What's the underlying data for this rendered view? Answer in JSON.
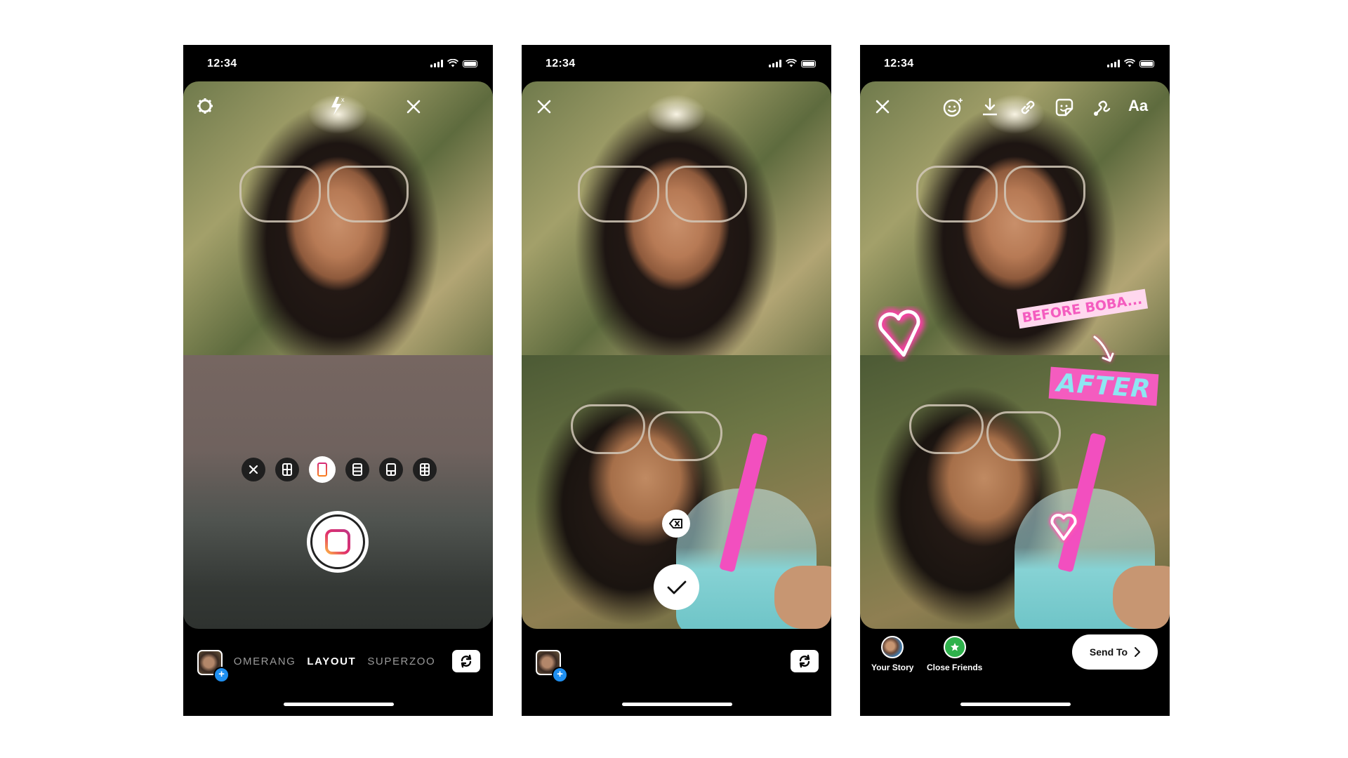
{
  "status_bar": {
    "time": "12:34"
  },
  "phone1": {
    "top_icons": [
      "settings-icon",
      "flash-off-icon",
      "close-icon"
    ],
    "layout_options": [
      {
        "name": "close-layout-icon",
        "selected": false
      },
      {
        "name": "grid-2x2-icon",
        "selected": false
      },
      {
        "name": "split-2-vertical-icon",
        "selected": true
      },
      {
        "name": "split-3-rows-icon",
        "selected": false
      },
      {
        "name": "split-top-bottom-2-icon",
        "selected": false
      },
      {
        "name": "grid-3x2-icon",
        "selected": false
      }
    ],
    "modes": {
      "prev": "BOOMERANG",
      "prev_visible": "OMERANG",
      "current": "LAYOUT",
      "next": "SUPERZOOM",
      "next_visible": "SUPERZOO"
    },
    "accent_gradient": [
      "#d62976",
      "#fa7e1e",
      "#feda75"
    ]
  },
  "phone2": {
    "top_icons": [
      "close-icon"
    ],
    "delete_label": "⌫",
    "confirm_label": "✓"
  },
  "phone3": {
    "toolbar": [
      "close-icon",
      "face-effects-icon",
      "download-icon",
      "link-icon",
      "sticker-icon",
      "draw-icon",
      "text-icon"
    ],
    "text_tool_label": "Aa",
    "stickers": {
      "before": "BEFORE BOBA...",
      "after": "AFTER"
    },
    "share": {
      "your_story": "Your Story",
      "close_friends": "Close Friends",
      "send_to": "Send To",
      "close_friends_color": "#2fb24c"
    }
  },
  "colors": {
    "sticker_pink": "#f45cbf",
    "after_text": "#8ee6f2",
    "before_bg": "#ffd8ee",
    "gallery_plus": "#1f8ff0"
  }
}
